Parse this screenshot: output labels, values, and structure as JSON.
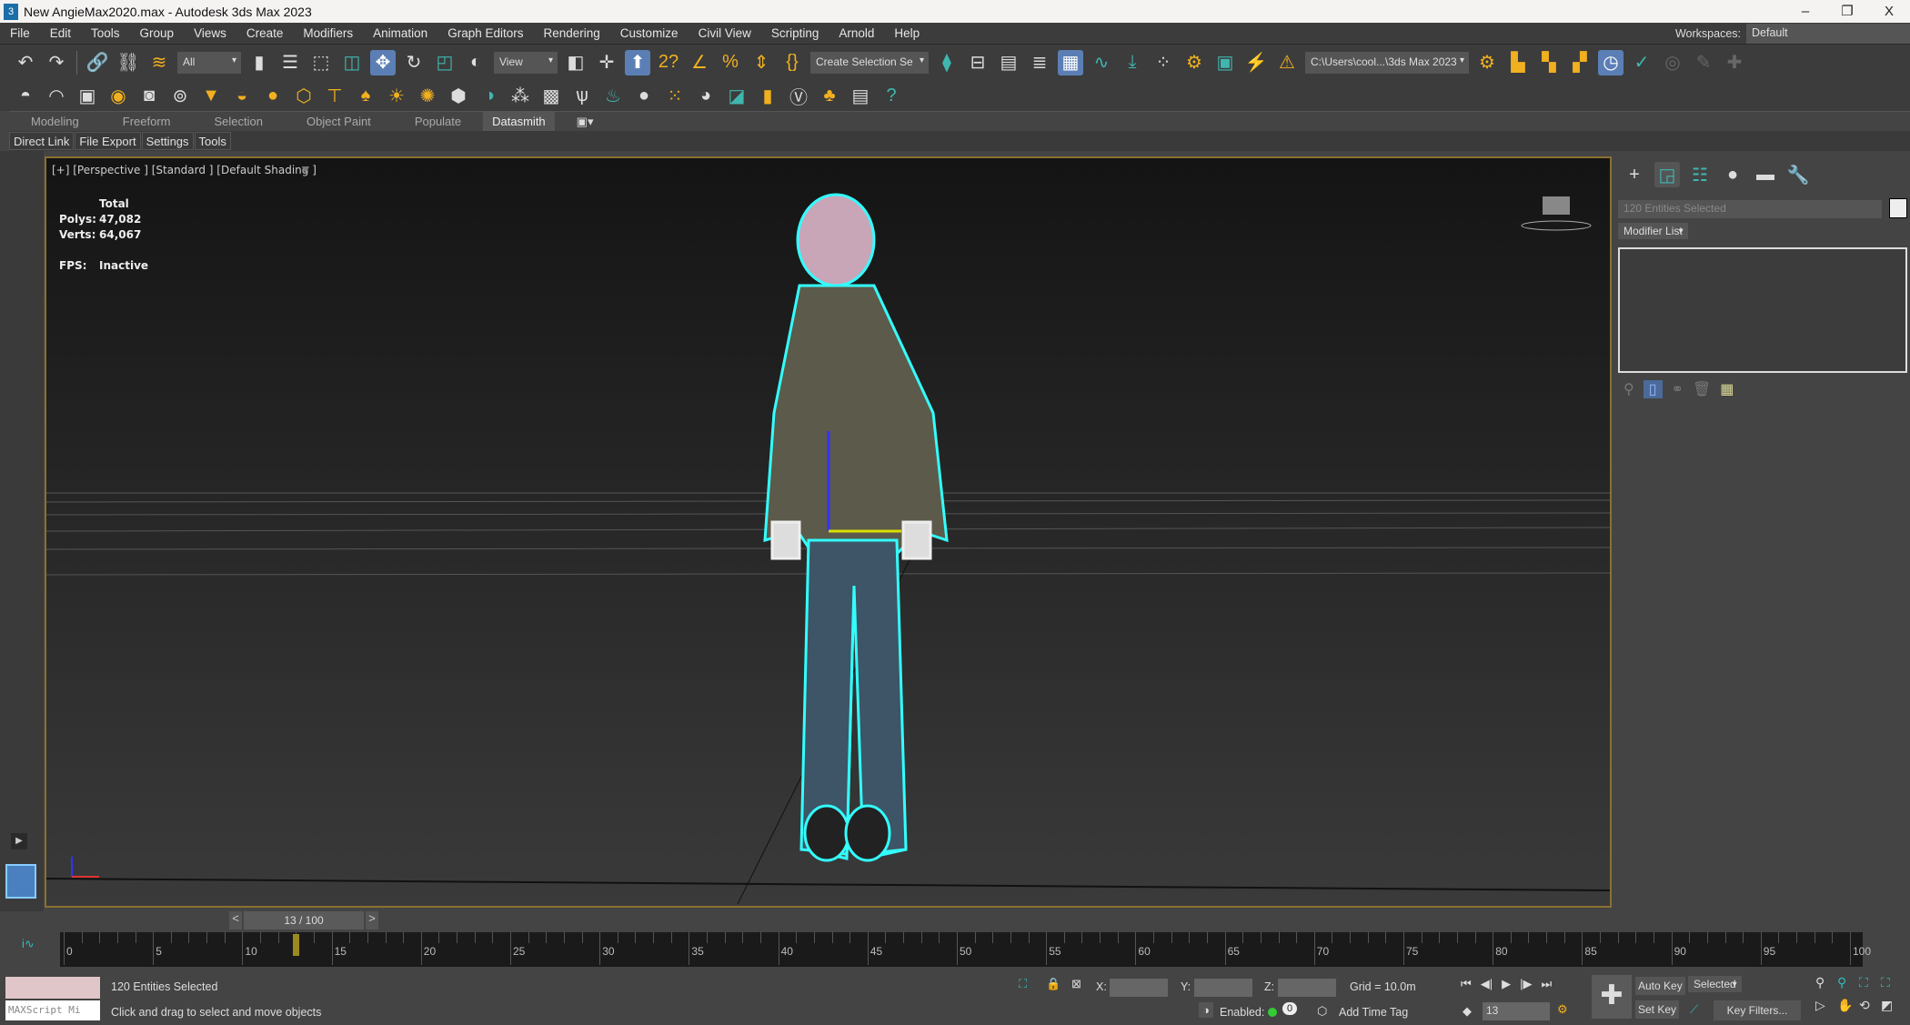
{
  "window": {
    "title": "New AngieMax2020.max - Autodesk 3ds Max 2023",
    "app_icon": "3",
    "minimize": "–",
    "maximize": "❐",
    "close": "X"
  },
  "menu": [
    "File",
    "Edit",
    "Tools",
    "Group",
    "Views",
    "Create",
    "Modifiers",
    "Animation",
    "Graph Editors",
    "Rendering",
    "Customize",
    "Civil View",
    "Scripting",
    "Arnold",
    "Help"
  ],
  "workspaces": {
    "label": "Workspaces:",
    "value": "Default"
  },
  "toolbar1": {
    "selection_filter": "All",
    "ref_coord": "View",
    "named_selection": "Create Selection Se",
    "project_path": "C:\\Users\\cool...\\3ds Max 2023"
  },
  "ribbon": {
    "tabs": [
      "Modeling",
      "Freeform",
      "Selection",
      "Object Paint",
      "Populate",
      "Datasmith"
    ],
    "active": "Datasmith",
    "sub": [
      "Direct Link",
      "File Export",
      "Settings",
      "Tools"
    ]
  },
  "viewport": {
    "label": "[+] [Perspective ] [Standard ] [Default Shading ]",
    "stats": {
      "total": "Total",
      "polys_label": "Polys:",
      "polys": "47,082",
      "verts_label": "Verts:",
      "verts": "64,067",
      "fps_label": "FPS:",
      "fps": "Inactive"
    }
  },
  "command_panel": {
    "name_field": "120 Entities Selected",
    "modifier_list": "Modifier List"
  },
  "time": {
    "slider": "13 / 100",
    "prev": "<",
    "next": ">",
    "current": 13,
    "end": 100,
    "labels": [
      "0",
      "5",
      "10",
      "15",
      "20",
      "25",
      "30",
      "35",
      "40",
      "45",
      "50",
      "55",
      "60",
      "65",
      "70",
      "75",
      "80",
      "85",
      "90",
      "95",
      "100"
    ]
  },
  "status": {
    "maxscript": "MAXScript Mi",
    "selected": "120 Entities Selected",
    "prompt": "Click and drag to select and move objects",
    "x": "X:",
    "y": "Y:",
    "z": "Z:",
    "grid": "Grid = 10.0m",
    "enabled": "Enabled:",
    "add_time_tag": "Add Time Tag",
    "frame": "13",
    "auto_key": "Auto Key",
    "set_key": "Set Key",
    "key_mode": "Selected",
    "key_filters": "Key Filters..."
  }
}
